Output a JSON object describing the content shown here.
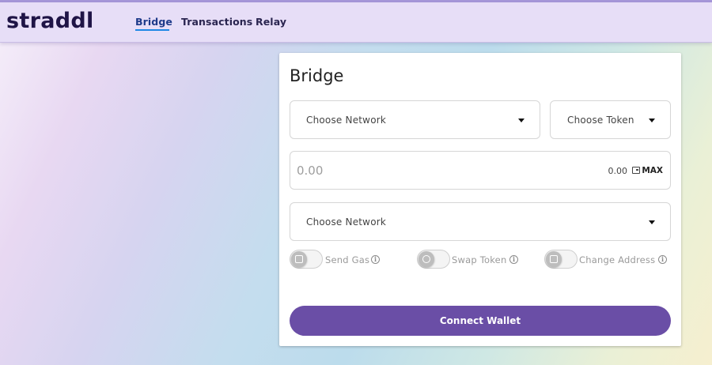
{
  "app": {
    "logo": "straddl"
  },
  "nav": {
    "items": [
      {
        "label": "Bridge",
        "active": true
      },
      {
        "label": "Transactions",
        "active": false
      },
      {
        "label": "Relay",
        "active": false
      }
    ]
  },
  "bridge": {
    "title": "Bridge",
    "source_network": {
      "label": "Choose Network"
    },
    "token": {
      "label": "Choose Token"
    },
    "amount": {
      "placeholder": "0.00",
      "balance": "0.00",
      "max_label": "MAX"
    },
    "destination_network": {
      "label": "Choose Network"
    },
    "options": [
      {
        "label": "Send Gas",
        "icon": "gas-icon",
        "enabled": false
      },
      {
        "label": "Swap Token",
        "icon": "swap-icon",
        "enabled": false
      },
      {
        "label": "Change Address",
        "icon": "address-icon",
        "enabled": false
      }
    ],
    "connect_button": "Connect Wallet"
  },
  "colors": {
    "accent": "#6a4ea6",
    "nav_bg": "#e7def7",
    "logo": "#1f1446",
    "active_underline": "#1e88e5"
  }
}
